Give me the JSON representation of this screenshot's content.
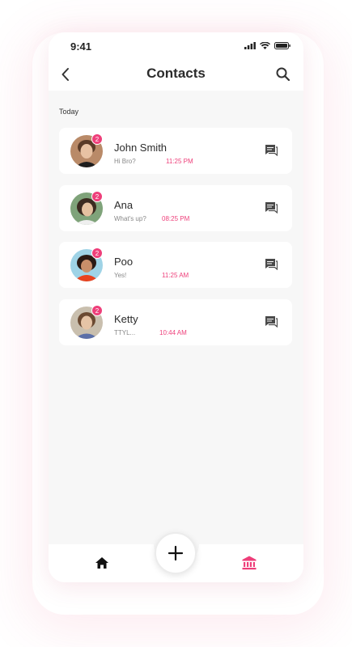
{
  "status_bar": {
    "time": "9:41"
  },
  "header": {
    "title": "Contacts"
  },
  "section": {
    "label": "Today"
  },
  "contacts": [
    {
      "name": "John Smith",
      "preview": "Hi Bro?",
      "time": "11:25 PM",
      "badge": "2"
    },
    {
      "name": "Ana",
      "preview": "What's up?",
      "time": "08:25 PM",
      "badge": "2"
    },
    {
      "name": "Poo",
      "preview": "Yes!",
      "time": "11:25 AM",
      "badge": "2"
    },
    {
      "name": "Ketty",
      "preview": "TTYL...",
      "time": "10:44 AM",
      "badge": "2"
    }
  ],
  "colors": {
    "accent": "#ee3f7a",
    "background": "#f7f7f7",
    "card": "#ffffff",
    "text": "#2b2b2b"
  },
  "icons": {
    "back": "chevron-left-icon",
    "search": "search-icon",
    "message": "chat-bubble-icon",
    "home": "home-icon",
    "add": "plus-icon",
    "bank": "bank-icon"
  }
}
